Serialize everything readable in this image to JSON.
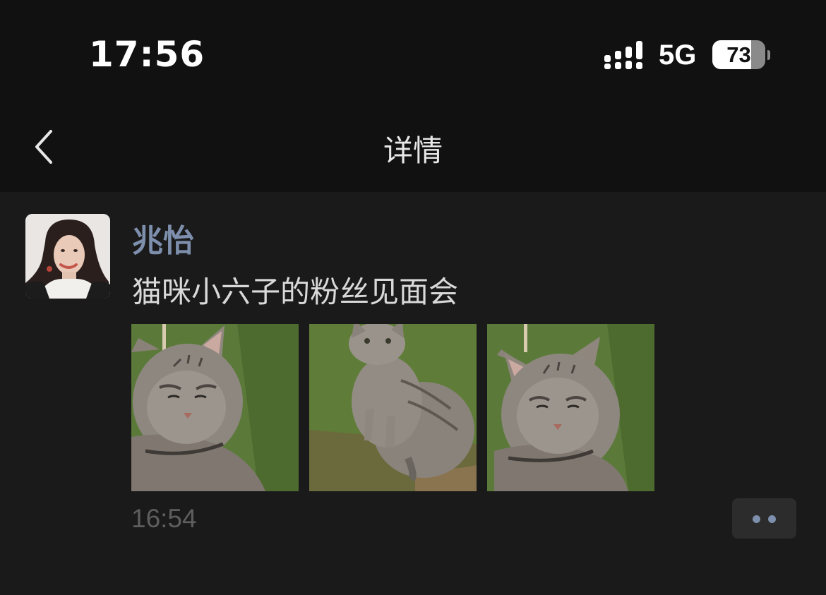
{
  "status_bar": {
    "time": "17:56",
    "network": "5G",
    "battery_level": 73,
    "battery_text": "73"
  },
  "nav": {
    "back_icon": "chevron-left-icon",
    "title": "详情"
  },
  "post": {
    "author": "兆怡",
    "text": "猫咪小六子的粉丝见面会",
    "photos": [
      {
        "subject": "cat-closeup-eyes-closed"
      },
      {
        "subject": "cat-sitting-on-grass"
      },
      {
        "subject": "cat-closeup-eyes-closed"
      }
    ],
    "timestamp": "16:54",
    "more_icon": "more-dots-icon"
  },
  "colors": {
    "background": "#1a1a1a",
    "header_background": "#111111",
    "author_name": "#7d8fac",
    "text": "#d9d9d9",
    "timestamp": "#5e5e5e",
    "more_button_bg": "#2c2c2c"
  }
}
